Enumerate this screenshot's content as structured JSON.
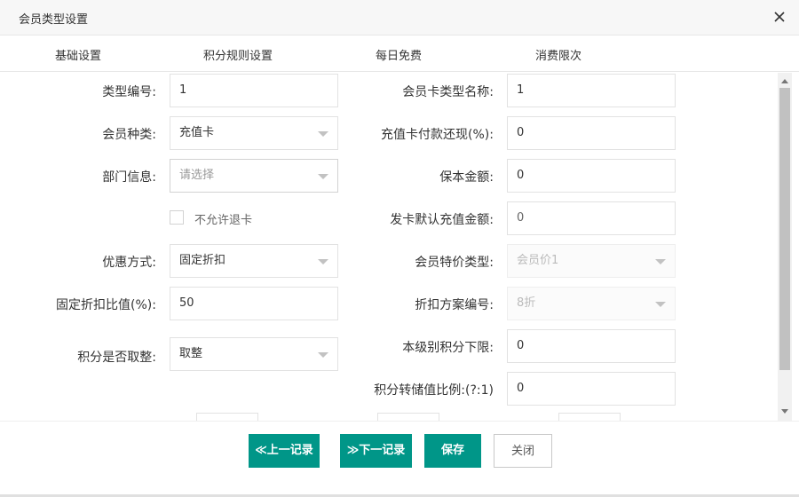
{
  "dialog": {
    "title": "会员类型设置"
  },
  "icons": {
    "close": "close-icon",
    "caret": "chevron-down-icon"
  },
  "tabs": [
    "基础设置",
    "积分规则设置",
    "每日免费",
    "消费限次"
  ],
  "form": {
    "type_no": {
      "label": "类型编号:",
      "value": "1"
    },
    "card_type_name": {
      "label": "会员卡类型名称:",
      "value": "1"
    },
    "member_kind": {
      "label": "会员种类:",
      "value": "充值卡"
    },
    "recharge_cashback": {
      "label": "充值卡付款还现(%):",
      "value": "0"
    },
    "department": {
      "label": "部门信息:",
      "placeholder": "请选择"
    },
    "principal_amount": {
      "label": "保本金额:",
      "value": "0"
    },
    "no_refund": {
      "label": "不允许退卡",
      "checked": false
    },
    "default_recharge": {
      "label": "发卡默认充值金额:",
      "value": "0"
    },
    "discount_mode": {
      "label": "优惠方式:",
      "value": "固定折扣"
    },
    "special_price_type": {
      "label": "会员特价类型:",
      "value": "会员价1"
    },
    "fixed_discount": {
      "label": "固定折扣比值(%):",
      "value": "50"
    },
    "discount_plan_no": {
      "label": "折扣方案编号:",
      "value": "8折"
    },
    "points_rounding": {
      "label": "积分是否取整:",
      "value": "取整"
    },
    "points_lower_limit": {
      "label": "本级别积分下限:",
      "value": "0"
    },
    "points_conversion": {
      "label": "积分转储值比例:(?:1)",
      "value": "0"
    }
  },
  "buttons": {
    "prev": "≪上一记录",
    "next": "≫下一记录",
    "save": "保存",
    "close": "关闭"
  },
  "colors": {
    "primary": "#009688",
    "border": "#e2e2e2"
  }
}
